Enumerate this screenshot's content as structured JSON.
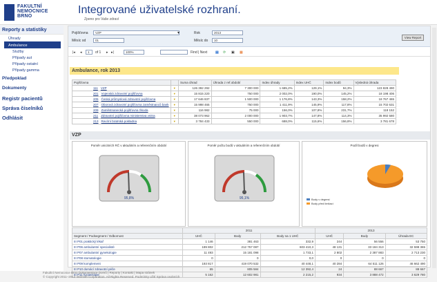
{
  "logo": {
    "l1": "FAKULTNÍ",
    "l2": "NEMOCNICE",
    "l3": "BRNO"
  },
  "app": {
    "title": "Integrované uživatelské rozhraní.",
    "subtitle": "Zpeno pro Vaše zdraví"
  },
  "sidebar": {
    "section": "Reporty a statistiky",
    "group": "Úhrady",
    "items": [
      "Ambulance",
      "Služby",
      "Případy aut",
      "Případy ostatní",
      "Případy gamma"
    ],
    "bottom": [
      "Předpoklad",
      "Dokumenty",
      "Registr pacientů",
      "Správa číselníků",
      "Odhlásit"
    ]
  },
  "params": {
    "pojistovna_label": "Pojišťovna",
    "pojistovna_value": "VZP",
    "mesic_od_label": "Měsíc od",
    "mesic_od_value": "01",
    "rok_label": "Rok",
    "rok_value": "2013",
    "mesic_do_label": "Měsíc do",
    "mesic_do_value": "10",
    "view_button": "View Report"
  },
  "toolbar": {
    "page": "1",
    "of": "of 1",
    "zoom": "100%",
    "find": "Find | Next"
  },
  "report": {
    "title": "Ambulance, rok 2013"
  },
  "table1": {
    "headers": [
      "Pojišťovna",
      "",
      "Suma úhrad",
      "Úhrada z ref.období",
      "Index úhrady",
      "Index UHČ",
      "Index bodů",
      "Výsledná úhrada"
    ],
    "rows": [
      [
        "111",
        "VZP",
        "126 392 292",
        "7 300 000",
        "1 685,2%",
        "129,1%",
        "94,3%",
        "123 828 490"
      ],
      [
        "201",
        "Vojenská zdravotní pojišťovna",
        "15 815 220",
        "750 000",
        "2 002,0%",
        "190,0%",
        "145,2%",
        "18 198 406"
      ],
      [
        "205",
        "Česká průmyslová zdravotní pojišťovna",
        "17 646 837",
        "1 500 000",
        "1 176,8%",
        "143,3%",
        "158,2%",
        "18 767 465"
      ],
      [
        "207",
        "Oborová zdravotní pojišťovna zaměstnanců bank",
        "15 998 465",
        "750 000",
        "1 411,9%",
        "145,9%",
        "117,8%",
        "15 702 631"
      ],
      [
        "209",
        "Zaměstnanecká pojišťovna Škoda",
        "116 982",
        "75 000",
        "156,0%",
        "107,8%",
        "231,7%",
        "118 152"
      ],
      [
        "211",
        "Zdravotní pojišťovna ministerstva vnitra",
        "38 073 962",
        "2 000 000",
        "1 903,7%",
        "147,8%",
        "114,3%",
        "35 992 580"
      ],
      [
        "213",
        "Revírní bratrská pokladna",
        "3 784 433",
        "550 000",
        "688,0%",
        "115,6%",
        "156,8%",
        "3 781 678"
      ]
    ]
  },
  "vzp": {
    "title": "VZP",
    "panel1": "Poměr unicitních RČ v aktuálním a referenčním období",
    "panel2": "Poměr počtu bodů v aktuálním a referenčním období",
    "panel3": "Podíl bodů v degresi",
    "gauge1": "95,8%",
    "gauge2": "95,1%",
    "legend1": "Body v degresi",
    "legend2": "Body před limitací"
  },
  "table2": {
    "h1": "Segment / Podsegment / Odbornost",
    "y1": "2011",
    "y2": "2013",
    "cols": [
      "UHČ",
      "Body",
      "Body na 1 UHČ",
      "UHČ",
      "Body",
      "Úhrada EC"
    ],
    "rows": [
      [
        "III P01 praktický lékař",
        "1 146",
        "381 463",
        "332,9",
        "244",
        "56 556",
        "53 750"
      ],
      [
        "III P06 ambulantní specialisté",
        "189 802",
        "212 757 087",
        "603 410,3",
        "48 131",
        "33 184 313",
        "32 598 365"
      ],
      [
        "III P07 ambulantní gynekologie",
        "11 493",
        "15 181 098",
        "1 733,1",
        "2 802",
        "2 387 883",
        "2 713 230"
      ],
      [
        "III P08 stomatologie",
        "0",
        "0",
        "0,0",
        "0",
        "0",
        "0"
      ],
      [
        "III P09 komplement",
        "193 817",
        "419 070 532",
        "40 448,1",
        "40 284",
        "64 511 126",
        "46 662 490"
      ],
      [
        "III P10 domácí zdravotní péče",
        "65",
        "805 584",
        "12 392,4",
        "24",
        "88 667",
        "88 667"
      ],
      [
        "III P11 fyzioterapie",
        "5 162",
        "12 602 981",
        "2 215,2",
        "934",
        "3 888 472",
        "3 629 780"
      ]
    ]
  },
  "footer": {
    "l1": "Fakultní Nemocnice Brno Dokumentace  Domů | Reporty | Kontakt | Mapa stránek",
    "l2": "© Copyright 2011–2013 Intersoft Corporation. All Rights Reserved.  Podmínky užití  Správa osobních"
  },
  "colors": {
    "brand": "#1f3f8a",
    "highlight": "#fde78a",
    "pie_orange": "#f59a2a",
    "pie_blue": "#4a7ec0"
  }
}
